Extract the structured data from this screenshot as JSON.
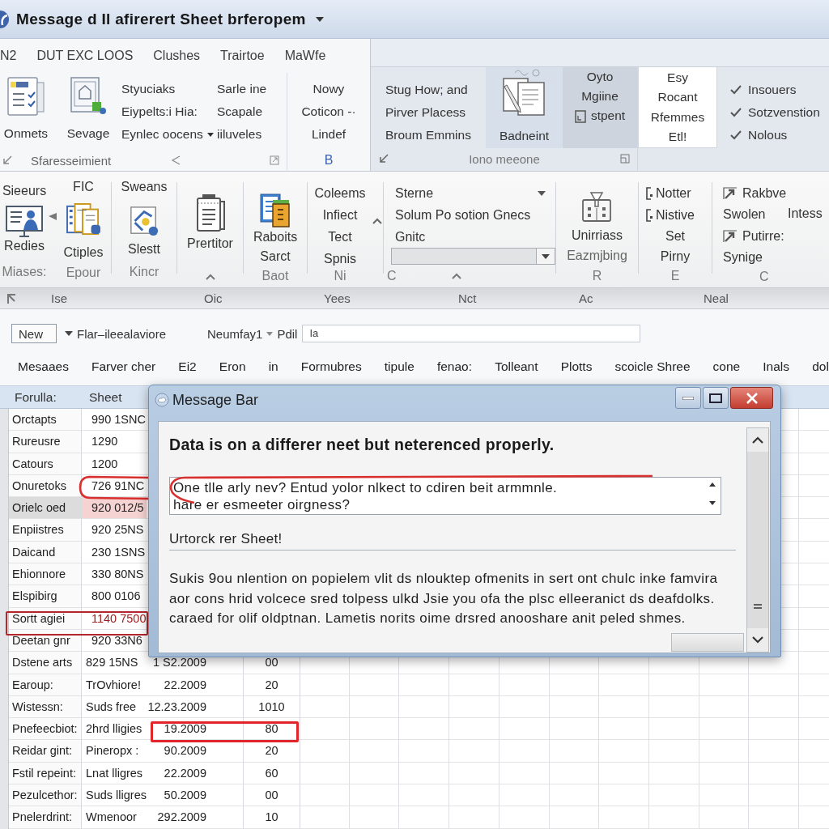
{
  "window": {
    "title": "Message d Il afirerert Sheet brferopem"
  },
  "tabs": [
    "N2",
    "DUT EXC LOOS",
    "Clushes",
    "Trairtoe",
    "MaWfe"
  ],
  "ribbon_top": {
    "group_1": {
      "buttons": [
        "Onmets",
        "Sevage"
      ],
      "column_1": [
        "Styuciaks",
        "Eiypelts:i Hia:",
        "Eynlec oocens"
      ],
      "column_2": [
        "Sarle ine",
        "Scapale",
        "iiluveles"
      ],
      "label": "Sfaresseimient"
    },
    "group_2": {
      "items": [
        "Nowy",
        "Coticon -·",
        "Lindef"
      ],
      "label": "B"
    },
    "group_3": {
      "items": [
        "Stug How; and",
        "Pirver Placess",
        "Broum Emmins"
      ],
      "button": "Badneint",
      "side_items": [
        "Oyto",
        "Mgiine",
        "stpent"
      ],
      "label": "Iono meeone"
    },
    "group_4": {
      "items": [
        "Esy",
        "Rocant",
        "Rfemmes",
        "Etl!"
      ]
    },
    "checks": [
      {
        "label": "Insouers",
        "checked": true
      },
      {
        "label": "Sotzvenstion",
        "checked": true
      },
      {
        "label": "Nolous",
        "checked": true
      }
    ]
  },
  "ribbon_bottom": {
    "group_1": {
      "buttons": [
        {
          "top": "Sieeurs",
          "label": "Redies",
          "footer": "Miases:"
        },
        {
          "top": "FIC",
          "label": "Ctiples",
          "footer": "Epour"
        }
      ]
    },
    "group_2": {
      "top": "Sweans",
      "label": "Slestt",
      "footer": "Kincr"
    },
    "group_3": {
      "label": "Prertitor"
    },
    "group_4": {
      "label": "Raboits",
      "sublabel": "Sarct",
      "footer": "Baot"
    },
    "group_5": {
      "items": [
        "Coleems",
        "Infiect",
        "Tect",
        "Spnis"
      ],
      "footer": "Ni"
    },
    "group_6": {
      "footer": "C",
      "style_label": "Sterne",
      "items": [
        "Solum Po sotion Gnecs",
        "Gnitc"
      ]
    },
    "group_7": {
      "label": "Unirriass",
      "sublabel": "Eazmjbing",
      "footer": "R"
    },
    "group_8": {
      "items": [
        {
          "kind": "icon",
          "label": "Notter"
        },
        {
          "kind": "icon",
          "label": "Nistive"
        },
        {
          "kind": "plain",
          "label": "Set"
        },
        {
          "kind": "plain",
          "label": "Pirny"
        }
      ],
      "footer": "E"
    },
    "group_9": {
      "items": [
        {
          "kind": "arrow",
          "label": "Rakbve"
        },
        {
          "kind": "plain",
          "label": "Swolen"
        },
        {
          "kind": "arrow",
          "label": "Putirre:"
        },
        {
          "kind": "plain",
          "label": "Synige"
        }
      ],
      "side": "Intess",
      "footer": "C"
    }
  },
  "column_bar": [
    "Ise",
    "Oic",
    "Yees",
    "Nct",
    "Ac",
    "Neal"
  ],
  "formula_bar": {
    "button": "New",
    "name": "Flar–ileealaviore",
    "font": "Neumfay1",
    "size": "Pdil",
    "value": "Ia"
  },
  "header_row": [
    "Mesaaes",
    "Farver cher",
    "Ei2",
    "Eron",
    "in",
    "Formubres",
    "tipule",
    "fenao:",
    "Tolleant",
    "Plotts",
    "scoicle Shree",
    "cone",
    "Inals",
    "dol"
  ],
  "sheet": {
    "columns": [
      "Forulla:",
      "Sheet"
    ],
    "rows": [
      {
        "kind": "plain",
        "label": "Orctapts",
        "value": "990 1SNC",
        "highlighted": false
      },
      {
        "kind": "plain",
        "label": "Rureusre",
        "value": "1290",
        "highlighted": false
      },
      {
        "kind": "plain",
        "label": "Catours",
        "value": "1200",
        "highlighted": false
      },
      {
        "kind": "circled",
        "label": "Onuretoks",
        "value": "726 91NC",
        "highlighted": false
      },
      {
        "kind": "plain",
        "label": "Orielc oed",
        "value": "920 012/5",
        "highlighted": true
      },
      {
        "kind": "plain",
        "label": "Enpiistres",
        "value": "920 25NS",
        "highlighted": false
      },
      {
        "kind": "plain",
        "label": "Daicand",
        "value": "230 1SNS",
        "highlighted": false
      },
      {
        "kind": "plain",
        "label": "Ehionnore",
        "value": "330 80NS",
        "highlighted": false
      },
      {
        "kind": "plain",
        "label": "Elspibirg",
        "value": "800 0106",
        "highlighted": false
      },
      {
        "kind": "boxed",
        "label": "Sortt agiei",
        "value": "1140 7500",
        "highlighted": false
      },
      {
        "kind": "plain",
        "label": "Deetan gnr",
        "value": "920 33N6",
        "highlighted": false
      },
      {
        "kind": "plain",
        "label": "Dstene arts",
        "value": "829 15NS",
        "date": "1 S2.2009",
        "number": "00",
        "highlighted": false
      },
      {
        "kind": "plain",
        "label": "Earoup:",
        "value": "TrOvhiore!",
        "date": "22.2009",
        "number": "20",
        "highlighted": false
      },
      {
        "kind": "plain",
        "label": "Wistessn:",
        "value": "Suds free",
        "date": "12.23.2009",
        "number": "1010",
        "highlighted": false
      },
      {
        "kind": "date_boxed",
        "label": "Pnefeecbiot:",
        "value": "2hrd lligies",
        "date": "19.2009",
        "number": "80",
        "highlighted": false
      },
      {
        "kind": "plain",
        "label": "Reidar gint:",
        "value": "Pineropx :",
        "date": "90.2009",
        "number": "20",
        "highlighted": false
      },
      {
        "kind": "plain",
        "label": "Fstil repeint:",
        "value": "Lnat lligres",
        "date": "22.2009",
        "number": "60",
        "highlighted": false
      },
      {
        "kind": "plain",
        "label": "Pezulcethor:",
        "value": "Suds lligres",
        "date": "50.2009",
        "number": "00",
        "highlighted": false
      },
      {
        "kind": "plain",
        "label": "Pnelerdrint:",
        "value": "Wmenoor",
        "date": "292.2009",
        "number": "10",
        "highlighted": false
      }
    ]
  },
  "dialog": {
    "title": "Message Bar",
    "heading": "Data is on a differer neet but neterenced properly.",
    "textbox": {
      "lines": [
        "One tlle arly nev? Entud yolor nlkect to cdiren beit armmnle.",
        "hare er esmeeter oirgness?"
      ],
      "marked": true
    },
    "subheading": "Urtorck rer Sheet!",
    "body_lines": [
      "Sukis 9ou nlention on popielem vlit ds nlouktep ofmenits in sert ont chulc inke famvira",
      "aor cons hrid volcece sred tolpess ulkd Jsie you ofa the plsc elleeranict ds deafdolks.",
      "caraed for olif oldptnan. Lametis norits oime drsred anooshare anit peled shmes."
    ]
  }
}
